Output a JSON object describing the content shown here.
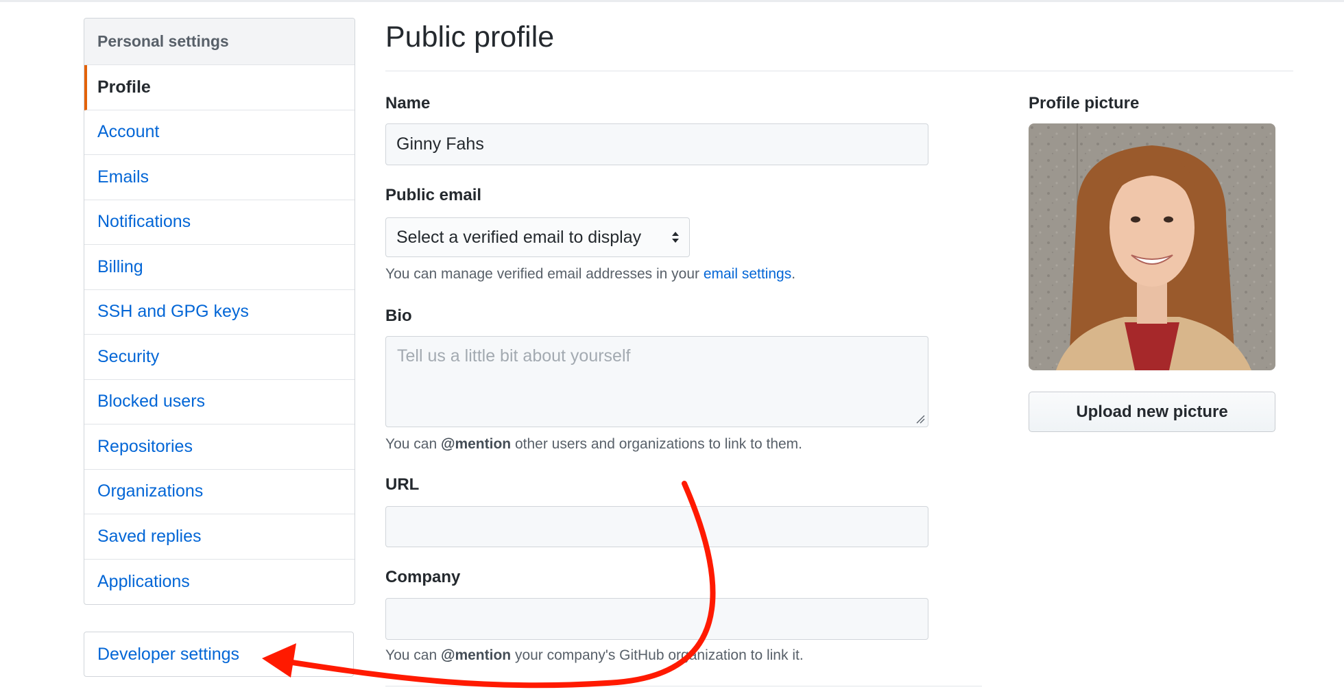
{
  "sidebar": {
    "header": "Personal settings",
    "items": [
      {
        "label": "Profile",
        "selected": true
      },
      {
        "label": "Account"
      },
      {
        "label": "Emails"
      },
      {
        "label": "Notifications"
      },
      {
        "label": "Billing"
      },
      {
        "label": "SSH and GPG keys"
      },
      {
        "label": "Security"
      },
      {
        "label": "Blocked users"
      },
      {
        "label": "Repositories"
      },
      {
        "label": "Organizations"
      },
      {
        "label": "Saved replies"
      },
      {
        "label": "Applications"
      }
    ],
    "developer_settings": "Developer settings"
  },
  "main": {
    "title": "Public profile",
    "name": {
      "label": "Name",
      "value": "Ginny Fahs"
    },
    "public_email": {
      "label": "Public email",
      "selected": "Select a verified email to display",
      "note_prefix": "You can manage verified email addresses in your ",
      "note_link": "email settings",
      "note_suffix": "."
    },
    "bio": {
      "label": "Bio",
      "placeholder": "Tell us a little bit about yourself",
      "note_prefix": "You can ",
      "note_bold": "@mention",
      "note_suffix": " other users and organizations to link to them."
    },
    "url": {
      "label": "URL",
      "value": ""
    },
    "company": {
      "label": "Company",
      "value": "",
      "note_prefix": "You can ",
      "note_bold": "@mention",
      "note_suffix": " your company's GitHub organization to link it."
    }
  },
  "profile_picture": {
    "label": "Profile picture",
    "upload_button": "Upload new picture"
  },
  "annotation": {
    "color": "#ff1a00",
    "type": "curved-arrow",
    "points_to": "Developer settings"
  }
}
